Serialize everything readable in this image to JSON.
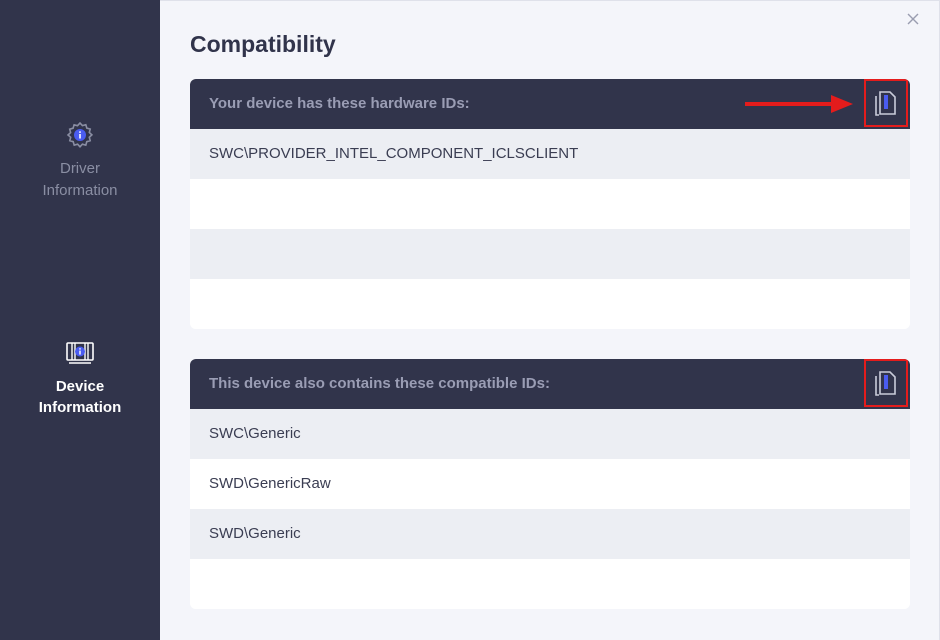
{
  "sidebar": {
    "items": [
      {
        "label_line1": "Driver",
        "label_line2": "Information",
        "icon": "gear-info-icon",
        "active": false
      },
      {
        "label_line1": "Device",
        "label_line2": "Information",
        "icon": "device-info-icon",
        "active": true
      }
    ]
  },
  "header": {
    "title": "Compatibility",
    "close_icon": "close-icon"
  },
  "hardware_ids": {
    "title": "Your device has these hardware IDs:",
    "copy_icon": "copy-icon",
    "rows": [
      "SWC\\PROVIDER_INTEL_COMPONENT_ICLSCLIENT",
      "",
      "",
      ""
    ]
  },
  "compatible_ids": {
    "title": "This device also contains these compatible IDs:",
    "copy_icon": "copy-icon",
    "rows": [
      "SWC\\Generic",
      "SWD\\GenericRaw",
      "SWD\\Generic",
      ""
    ]
  },
  "colors": {
    "sidebar": "#31344b",
    "accent": "#4a5cf0",
    "highlight_box": "#e41c1c"
  }
}
